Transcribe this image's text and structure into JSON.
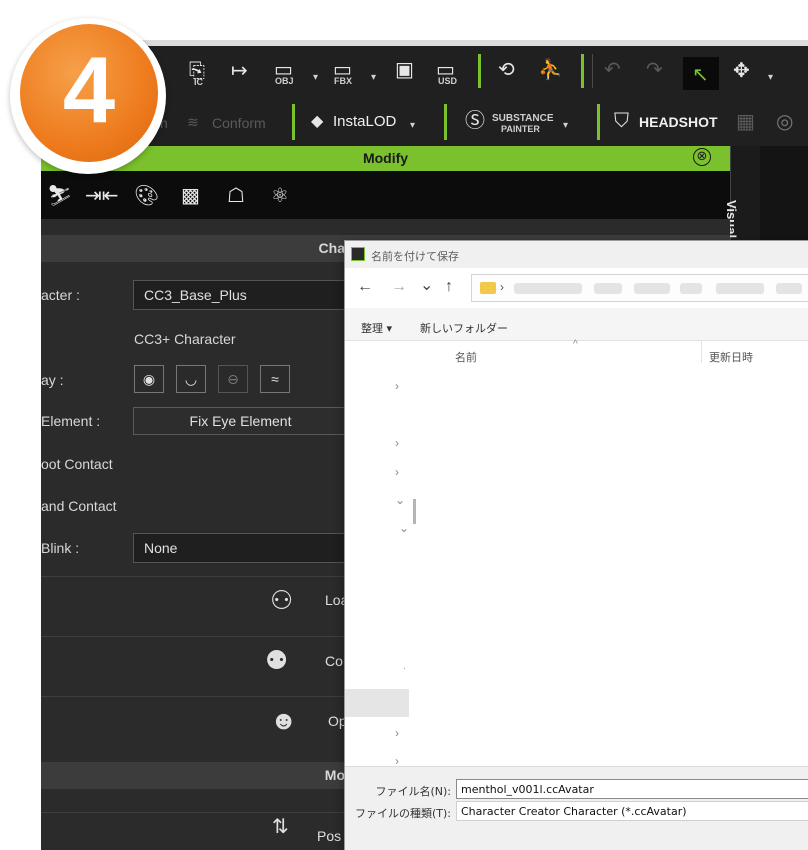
{
  "badge": {
    "number": "4"
  },
  "toolbar": {
    "row1_icons": [
      {
        "name": "ic-export-icon",
        "label": "IC"
      },
      {
        "name": "export-icon",
        "label": ""
      },
      {
        "name": "obj-export-icon",
        "label": "OBJ"
      },
      {
        "name": "fbx-export-icon",
        "label": "FBX"
      },
      {
        "name": "screen-icon",
        "label": ""
      },
      {
        "name": "usd-export-icon",
        "label": "USD"
      },
      {
        "name": "rotate-view-icon",
        "label": ""
      },
      {
        "name": "pose-icon",
        "label": ""
      },
      {
        "name": "undo-icon",
        "label": ""
      },
      {
        "name": "redo-icon",
        "label": ""
      },
      {
        "name": "select-icon",
        "label": ""
      },
      {
        "name": "move-icon",
        "label": ""
      }
    ],
    "row2": {
      "partial_left": "n",
      "conform_label": "Conform",
      "instalod_label": "InstaLOD",
      "substance_label_top": "SUBSTANCE",
      "substance_label_bottom": "PAINTER",
      "headshot_label": "HEADSHOT"
    },
    "accent_color": "#7ac12d"
  },
  "modify": {
    "title": "Modify",
    "close_symbol": "⊗",
    "tab_icons": [
      "motion-icon",
      "align-icon",
      "palette-icon",
      "checker-icon",
      "head-icon",
      "atom-icon"
    ]
  },
  "visual_tab": "Visual",
  "character_section": {
    "title": "Cha",
    "character_label": "acter :",
    "character_value": "CC3_Base_Plus",
    "type_label": "",
    "type_value": "CC3+ Character",
    "display_label": "ay :",
    "eye_element_label": "Element :",
    "fix_eye_button": "Fix Eye Element",
    "foot_contact_label": "oot Contact",
    "hand_contact_label": "and Contact",
    "blink_label": "Blink :",
    "blink_value": "None"
  },
  "actions": [
    {
      "icon": "load-head-icon",
      "label": "Loa"
    },
    {
      "icon": "convert-head-icon",
      "label": "Co"
    },
    {
      "icon": "optimize-head-icon",
      "label": "Op"
    }
  ],
  "motion_section": {
    "title": "Mo",
    "pose_label": "Pos"
  },
  "dialog": {
    "title": "名前を付けて保存",
    "nav": {
      "back": "←",
      "forward": "→",
      "dropdown": "⌄",
      "up": "↑"
    },
    "address_sep": "›",
    "organize_label": "整理 ▾",
    "new_folder_label": "新しいフォルダー",
    "col_name": "名前",
    "col_date": "更新日時",
    "filename_label": "ファイル名(N):",
    "filename_value": "menthol_v001l.ccAvatar",
    "filetype_label": "ファイルの種類(T):",
    "filetype_value": "Character Creator Character (*.ccAvatar)"
  }
}
